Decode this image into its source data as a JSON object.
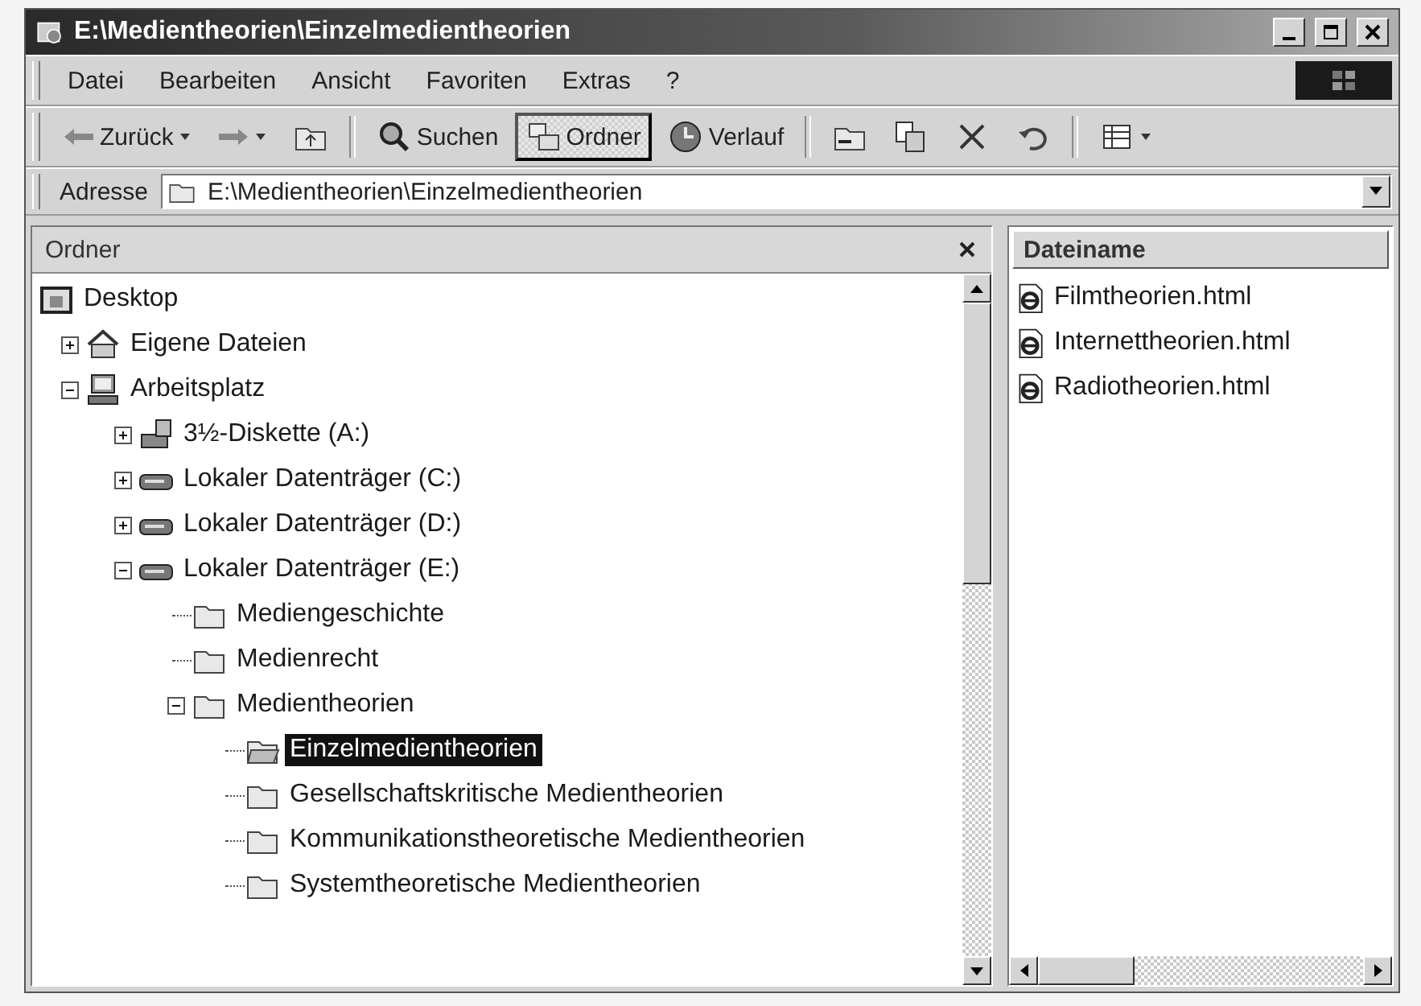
{
  "window": {
    "title": "E:\\Medientheorien\\Einzelmedientheorien"
  },
  "menu": [
    "Datei",
    "Bearbeiten",
    "Ansicht",
    "Favoriten",
    "Extras",
    "?"
  ],
  "toolbar": {
    "buttons": [
      {
        "label": "Zurück",
        "pressed": false
      },
      {
        "label": "Suchen",
        "pressed": false
      },
      {
        "label": "Ordner",
        "pressed": true
      },
      {
        "label": "Verlauf",
        "pressed": false
      }
    ]
  },
  "address": {
    "label": "Adresse",
    "value": "E:\\Medientheorien\\Einzelmedientheorien"
  },
  "folders_pane": {
    "title": "Ordner",
    "tree": [
      {
        "label": "Desktop",
        "kind": "desktop",
        "selected": false,
        "children": [
          {
            "label": "Eigene Dateien",
            "kind": "documents",
            "expanded": false,
            "selected": false
          },
          {
            "label": "Arbeitsplatz",
            "kind": "computer",
            "expanded": true,
            "selected": false,
            "children": [
              {
                "label": "3½-Diskette (A:)",
                "kind": "floppy",
                "expanded": false,
                "selected": false
              },
              {
                "label": "Lokaler Datenträger (C:)",
                "kind": "drive",
                "expanded": false,
                "selected": false
              },
              {
                "label": "Lokaler Datenträger (D:)",
                "kind": "drive",
                "expanded": false,
                "selected": false
              },
              {
                "label": "Lokaler Datenträger (E:)",
                "kind": "drive",
                "expanded": true,
                "selected": false,
                "children": [
                  {
                    "label": "Mediengeschichte",
                    "kind": "folder",
                    "selected": false
                  },
                  {
                    "label": "Medienrecht",
                    "kind": "folder",
                    "selected": false
                  },
                  {
                    "label": "Medientheorien",
                    "kind": "folder",
                    "expanded": true,
                    "selected": false,
                    "children": [
                      {
                        "label": "Einzelmedientheorien",
                        "kind": "folder",
                        "selected": true
                      },
                      {
                        "label": "Gesellschaftskritische Medientheorien",
                        "kind": "folder",
                        "selected": false
                      },
                      {
                        "label": "Kommunikationstheoretische Medientheorien",
                        "kind": "folder",
                        "selected": false
                      },
                      {
                        "label": "Systemtheoretische Medientheorien",
                        "kind": "folder",
                        "selected": false
                      }
                    ]
                  }
                ]
              }
            ]
          }
        ]
      }
    ]
  },
  "files_pane": {
    "column": "Dateiname",
    "files": [
      "Filmtheorien.html",
      "Internettheorien.html",
      "Radiotheorien.html"
    ]
  }
}
